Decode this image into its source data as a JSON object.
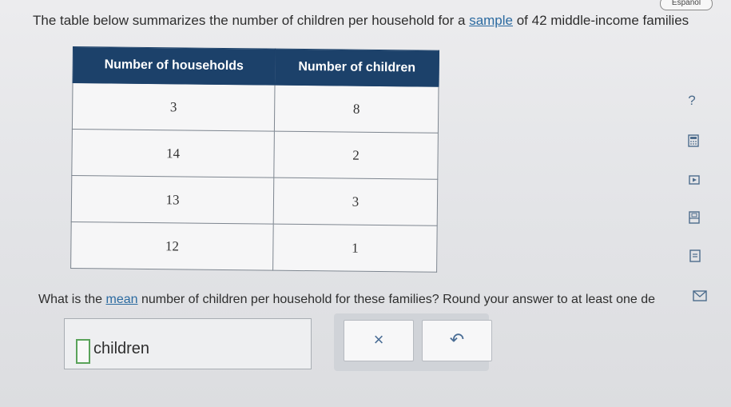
{
  "header": {
    "language_button": "Español"
  },
  "prompt": {
    "part1": "The table below summarizes the number of children per household for a ",
    "link": "sample",
    "part2": " of 42 middle-income families"
  },
  "table": {
    "headers": [
      "Number of households",
      "Number of children"
    ],
    "rows": [
      [
        "3",
        "8"
      ],
      [
        "14",
        "2"
      ],
      [
        "13",
        "3"
      ],
      [
        "12",
        "1"
      ]
    ]
  },
  "side_tools": {
    "help_glyph": "?",
    "icons": [
      "help-icon",
      "calculator-icon",
      "video-icon",
      "data-icon",
      "glossary-icon",
      "mail-icon"
    ]
  },
  "question": {
    "part1": "What is the ",
    "link": "mean",
    "part2": " number of children per household for these families? Round your answer to at least one de"
  },
  "answer": {
    "input_value": "",
    "unit": "children"
  },
  "buttons": {
    "clear": "×",
    "undo": "↶"
  },
  "colors": {
    "header_bg": "#1c416a",
    "link": "#2b6aa0",
    "input_border": "#5aa35a"
  }
}
